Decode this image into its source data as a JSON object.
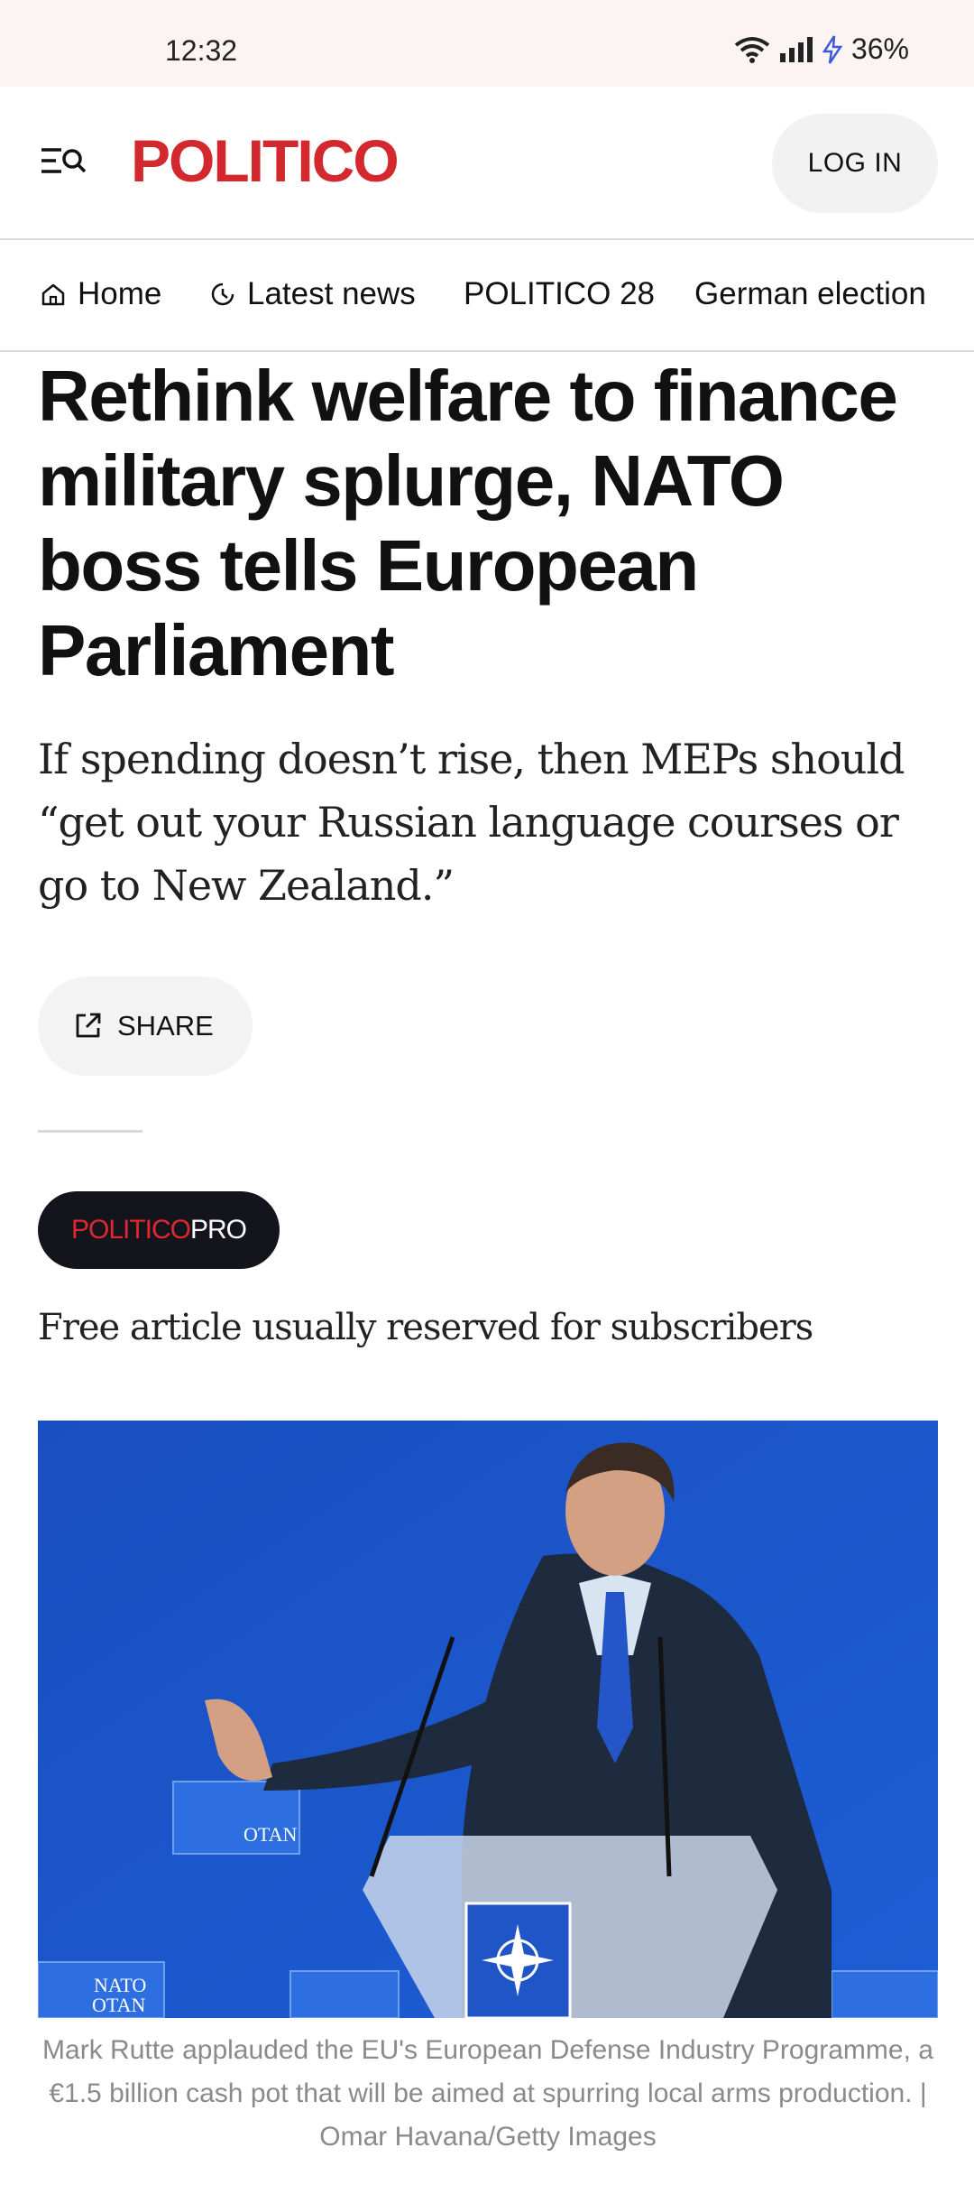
{
  "status_bar": {
    "time": "12:32",
    "battery": "36%"
  },
  "header": {
    "logo": "POLITICO",
    "login_label": "LOG IN"
  },
  "nav": {
    "items": [
      {
        "label": "Home",
        "icon": "home-icon"
      },
      {
        "label": "Latest news",
        "icon": "clock-icon"
      },
      {
        "label": "POLITICO 28"
      },
      {
        "label": "German election"
      }
    ]
  },
  "article": {
    "headline": "Rethink welfare to finance military splurge, NATO boss tells European Parliament",
    "subhead": "If spending doesn’t rise, then MEPs should “get out your Russian language courses or go to New Zealand.”",
    "share_label": "SHARE",
    "badge": {
      "part1": "POLITICO",
      "part2": "PRO"
    },
    "free_note": "Free article usually reserved for subscribers",
    "image": {
      "sign_text_top": "NATO",
      "sign_text_bottom": "OTAN"
    },
    "caption": "Mark Rutte applauded the EU's European Defense Industry Programme, a €1.5 billion cash pot that will be aimed at spurring local arms production. | Omar Havana/Getty Images"
  },
  "colors": {
    "brand_red": "#d3282d",
    "photo_blue": "#1a55c8",
    "badge_dark": "#14141c"
  }
}
